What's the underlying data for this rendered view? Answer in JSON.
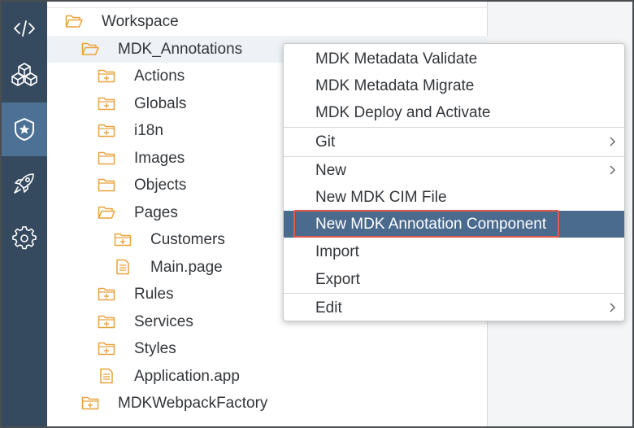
{
  "colors": {
    "activity_bar": "#354a5f",
    "activity_active": "#4d7194",
    "folder_icon": "#e9a23b",
    "file_icon": "#e9a23b",
    "menu_highlight": "#4a6a8e",
    "focus_outline": "#e05a4c"
  },
  "activity_bar": {
    "items": [
      {
        "icon": "code-icon",
        "active": false
      },
      {
        "icon": "cubes-icon",
        "active": false
      },
      {
        "icon": "shield-star-icon",
        "active": true
      },
      {
        "icon": "rocket-icon",
        "active": false
      },
      {
        "icon": "gear-icon",
        "active": false
      }
    ]
  },
  "explorer": {
    "items": [
      {
        "label": "Workspace",
        "icon": "folder-open-icon",
        "level": 0
      },
      {
        "label": "MDK_Annotations",
        "icon": "folder-open-icon",
        "level": 1,
        "selected": true
      },
      {
        "label": "Actions",
        "icon": "folder-plus-icon",
        "level": 2
      },
      {
        "label": "Globals",
        "icon": "folder-plus-icon",
        "level": 2
      },
      {
        "label": "i18n",
        "icon": "folder-plus-icon",
        "level": 2
      },
      {
        "label": "Images",
        "icon": "folder-icon",
        "level": 2
      },
      {
        "label": "Objects",
        "icon": "folder-icon",
        "level": 2
      },
      {
        "label": "Pages",
        "icon": "folder-open-icon",
        "level": 2
      },
      {
        "label": "Customers",
        "icon": "folder-plus-icon",
        "level": 3
      },
      {
        "label": "Main.page",
        "icon": "file-icon",
        "level": 3
      },
      {
        "label": "Rules",
        "icon": "folder-plus-icon",
        "level": 2
      },
      {
        "label": "Services",
        "icon": "folder-plus-icon",
        "level": 2
      },
      {
        "label": "Styles",
        "icon": "folder-plus-icon",
        "level": 2
      },
      {
        "label": "Application.app",
        "icon": "file-icon",
        "level": 2
      },
      {
        "label": "MDKWebpackFactory",
        "icon": "folder-plus-icon",
        "level": 1
      }
    ]
  },
  "context_menu": {
    "items": [
      {
        "label": "MDK Metadata Validate"
      },
      {
        "label": "MDK Metadata Migrate"
      },
      {
        "label": "MDK Deploy and Activate"
      },
      {
        "label": "Git",
        "submenu": true
      },
      {
        "label": "New",
        "submenu": true
      },
      {
        "label": "New MDK CIM File"
      },
      {
        "label": "New MDK Annotation Component",
        "highlighted": true
      },
      {
        "label": "Import"
      },
      {
        "label": "Export"
      },
      {
        "label": "Edit",
        "submenu": true
      }
    ]
  }
}
